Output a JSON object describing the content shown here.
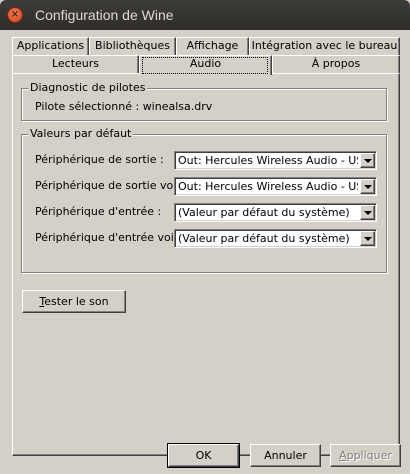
{
  "window": {
    "title": "Configuration de Wine"
  },
  "tabs": {
    "row1": [
      {
        "label": "Applications"
      },
      {
        "label": "Bibliothèques"
      },
      {
        "label": "Affichage"
      },
      {
        "label": "Intégration avec le bureau"
      }
    ],
    "row2": [
      {
        "label": "Lecteurs"
      },
      {
        "label": "Audio",
        "active": true
      },
      {
        "label": "À propos"
      }
    ]
  },
  "diagnostics": {
    "title": "Diagnostic de pilotes",
    "driver_text": "Pilote sélectionné : winealsa.drv"
  },
  "defaults": {
    "title": "Valeurs par défaut",
    "rows": [
      {
        "label": "Périphérique de sortie :",
        "value": "Out: Hercules Wireless Audio - USB Audio"
      },
      {
        "label": "Périphérique de sortie voix :",
        "value": "Out: Hercules Wireless Audio - USB Audio"
      },
      {
        "label": "Périphérique d'entrée :",
        "value": "(Valeur par défaut du système)"
      },
      {
        "label": "Périphérique d'entrée voix :",
        "value": "(Valeur par défaut du système)"
      }
    ]
  },
  "test_sound": {
    "mnemonic": "T",
    "rest": "ester le son"
  },
  "footer": {
    "ok": "OK",
    "cancel": "Annuler",
    "apply_mnemonic": "A",
    "apply_rest": "ppliquer"
  }
}
